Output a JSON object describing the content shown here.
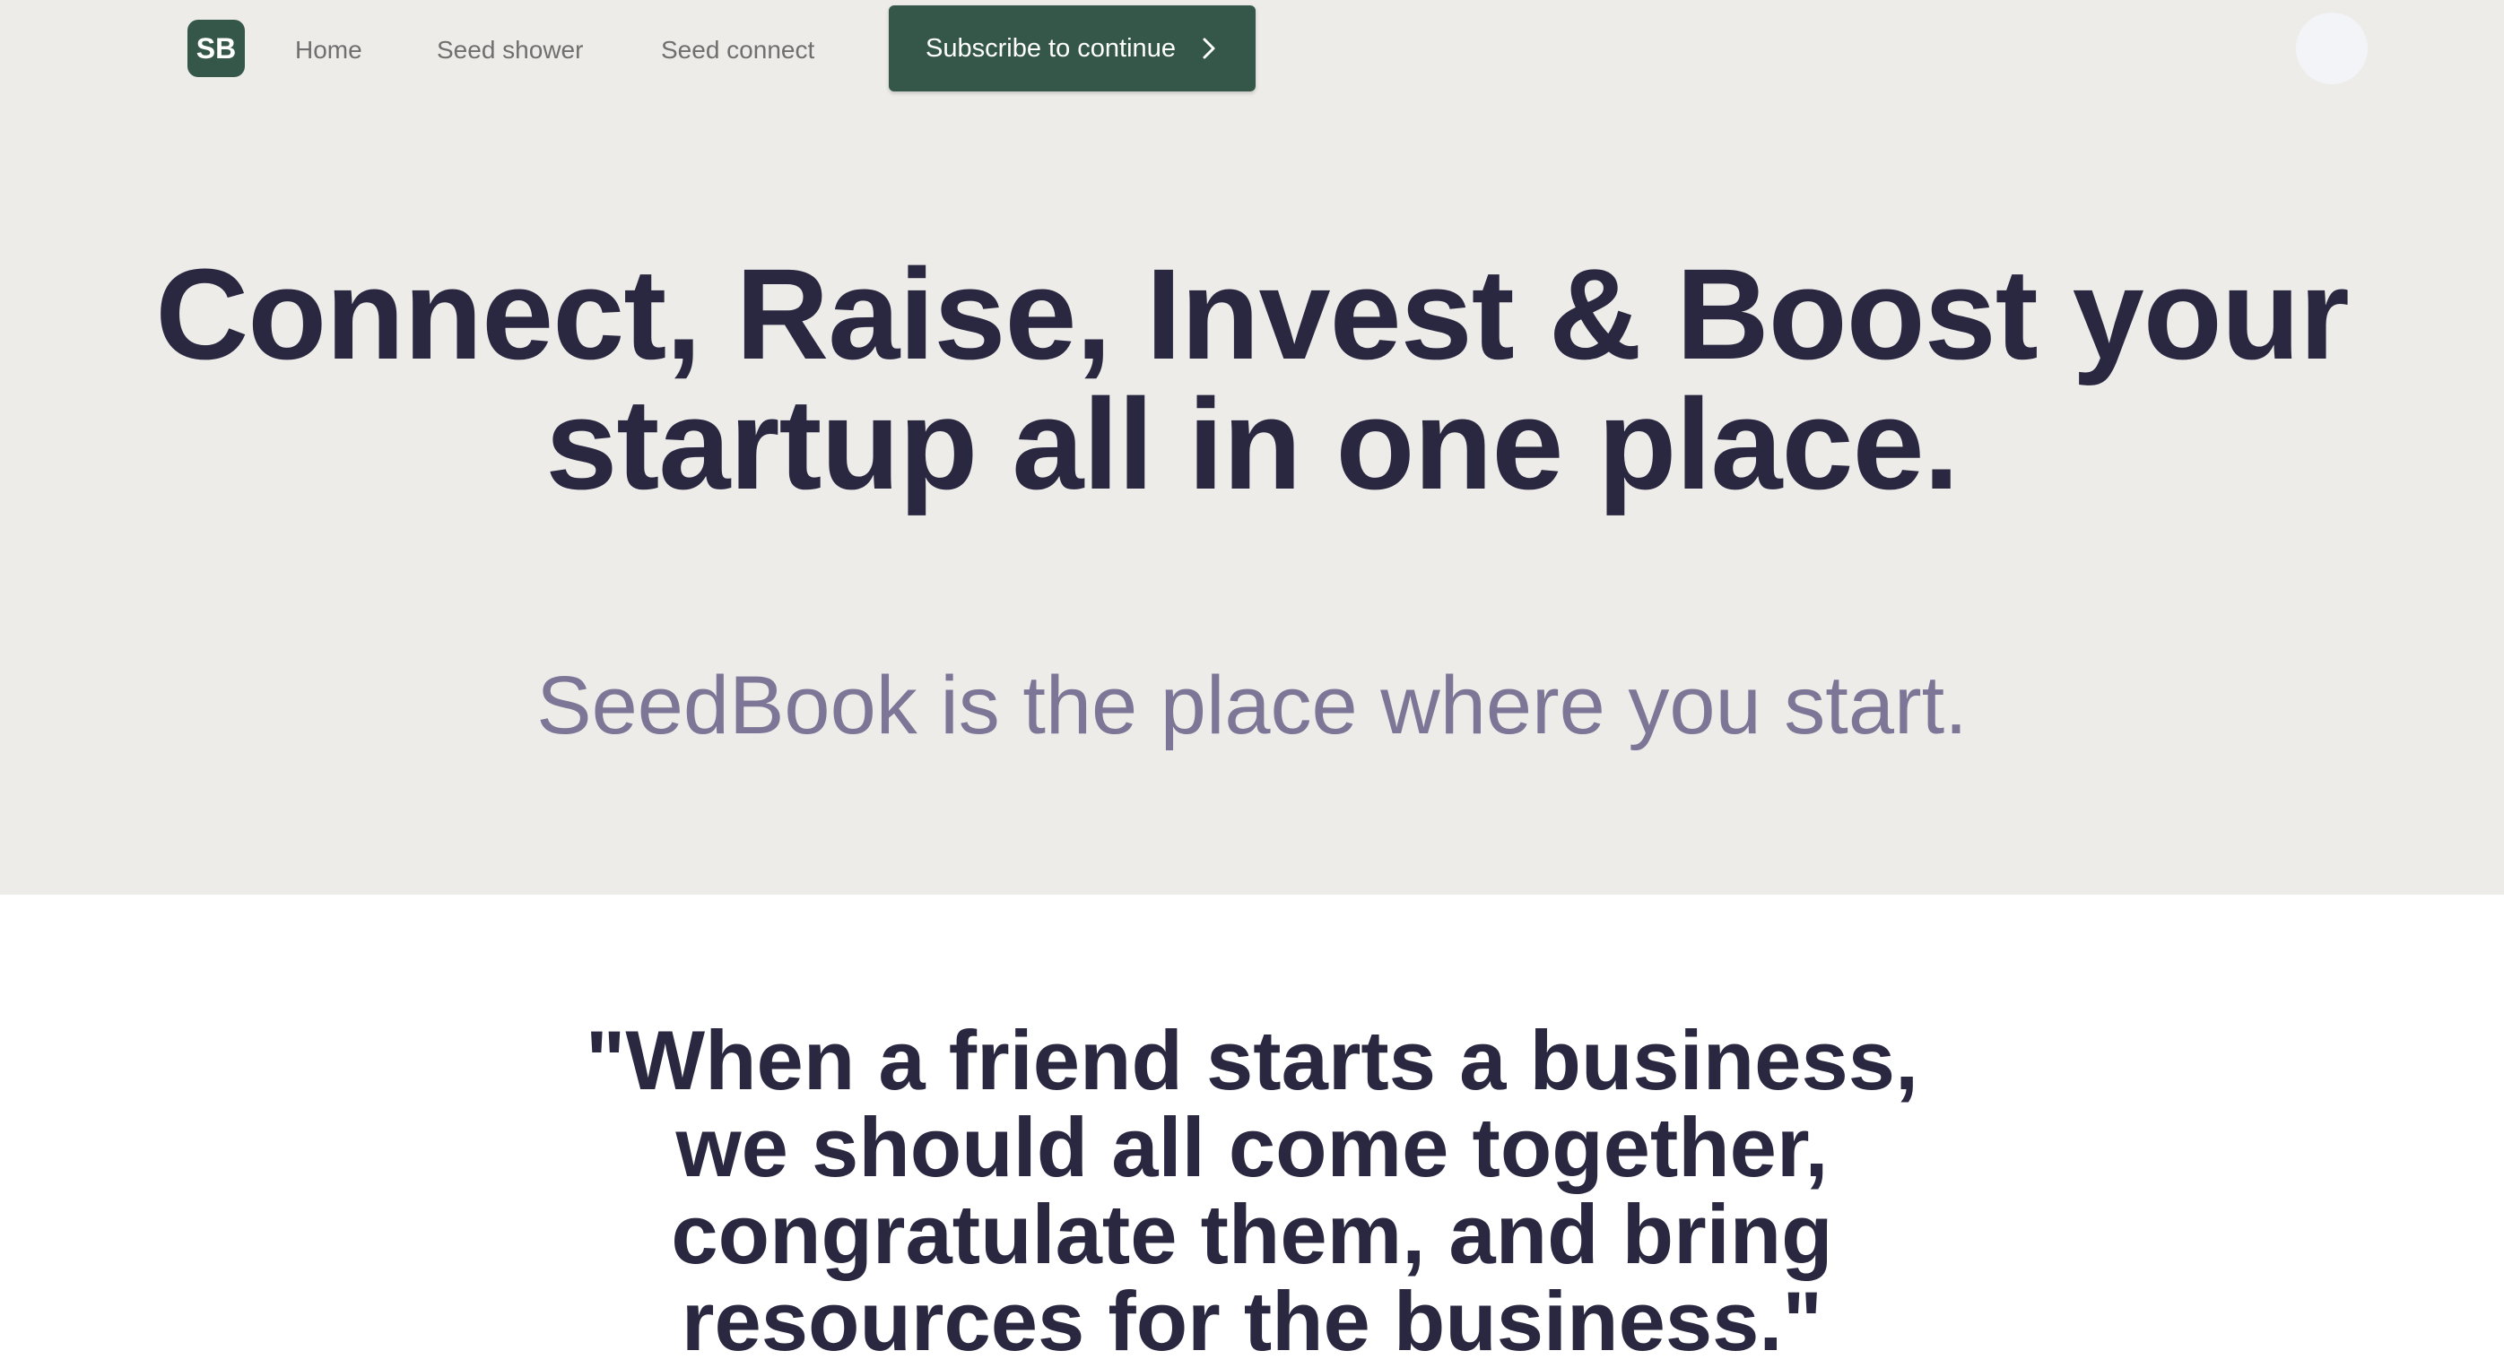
{
  "nav": {
    "logo_text": "SB",
    "links": [
      {
        "label": "Home"
      },
      {
        "label": "Seed shower"
      },
      {
        "label": "Seed connect"
      }
    ],
    "subscribe_label": "Subscribe to continue"
  },
  "hero": {
    "title_line1": "Connect, Raise, Invest & Boost your",
    "title_line2": "startup all in one place.",
    "subtitle": "SeedBook is the place where you start."
  },
  "quote": {
    "lines": [
      "\"When a friend starts a business,",
      "we should all come together,",
      "congratulate them, and bring",
      "resources for the business.\""
    ]
  },
  "colors": {
    "brand": "#35574a",
    "hero_bg": "#eeece9",
    "heading": "#2a2840",
    "subtitle": "#7d7696"
  }
}
